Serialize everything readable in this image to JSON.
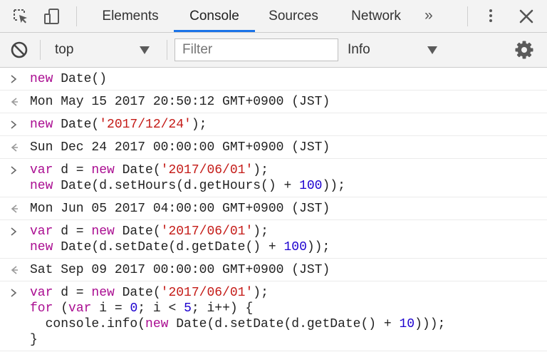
{
  "tabs": {
    "items": [
      "Elements",
      "Console",
      "Sources",
      "Network"
    ],
    "active": "Console",
    "more_label": "»"
  },
  "toolbar": {
    "context_value": "top",
    "filter_placeholder": "Filter",
    "level_value": "Info"
  },
  "icons": {
    "inspect": "inspect-element-icon",
    "device": "device-toolbar-icon",
    "more_tabs": "chevron-double-right-icon",
    "menu": "kebab-menu-icon",
    "close": "close-icon",
    "clear": "clear-console-icon",
    "dropdown": "chevron-down-icon",
    "settings": "gear-icon",
    "input_prompt": "input-prompt-icon",
    "result_prompt": "result-prompt-icon"
  },
  "colors": {
    "accent": "#1a73e8",
    "keyword": "#aa0d91",
    "string": "#c41a16",
    "number": "#1c00cf",
    "text": "#222222"
  },
  "console": {
    "entries": [
      {
        "kind": "input",
        "lines": [
          [
            [
              "kw",
              "new"
            ],
            [
              "plain",
              " Date()"
            ]
          ]
        ]
      },
      {
        "kind": "result",
        "lines": [
          [
            [
              "plain",
              "Mon May 15 2017 20:50:12 GMT+0900 (JST)"
            ]
          ]
        ]
      },
      {
        "kind": "input",
        "lines": [
          [
            [
              "kw",
              "new"
            ],
            [
              "plain",
              " Date("
            ],
            [
              "str",
              "'2017/12/24'"
            ],
            [
              "plain",
              ");"
            ]
          ]
        ]
      },
      {
        "kind": "result",
        "lines": [
          [
            [
              "plain",
              "Sun Dec 24 2017 00:00:00 GMT+0900 (JST)"
            ]
          ]
        ]
      },
      {
        "kind": "input",
        "lines": [
          [
            [
              "kw",
              "var"
            ],
            [
              "plain",
              " d = "
            ],
            [
              "kw",
              "new"
            ],
            [
              "plain",
              " Date("
            ],
            [
              "str",
              "'2017/06/01'"
            ],
            [
              "plain",
              ");"
            ]
          ],
          [
            [
              "kw",
              "new"
            ],
            [
              "plain",
              " Date(d.setHours(d.getHours() + "
            ],
            [
              "num",
              "100"
            ],
            [
              "plain",
              "));"
            ]
          ]
        ]
      },
      {
        "kind": "result",
        "lines": [
          [
            [
              "plain",
              "Mon Jun 05 2017 04:00:00 GMT+0900 (JST)"
            ]
          ]
        ]
      },
      {
        "kind": "input",
        "lines": [
          [
            [
              "kw",
              "var"
            ],
            [
              "plain",
              " d = "
            ],
            [
              "kw",
              "new"
            ],
            [
              "plain",
              " Date("
            ],
            [
              "str",
              "'2017/06/01'"
            ],
            [
              "plain",
              ");"
            ]
          ],
          [
            [
              "kw",
              "new"
            ],
            [
              "plain",
              " Date(d.setDate(d.getDate() + "
            ],
            [
              "num",
              "100"
            ],
            [
              "plain",
              "));"
            ]
          ]
        ]
      },
      {
        "kind": "result",
        "lines": [
          [
            [
              "plain",
              "Sat Sep 09 2017 00:00:00 GMT+0900 (JST)"
            ]
          ]
        ]
      },
      {
        "kind": "input",
        "lines": [
          [
            [
              "kw",
              "var"
            ],
            [
              "plain",
              " d = "
            ],
            [
              "kw",
              "new"
            ],
            [
              "plain",
              " Date("
            ],
            [
              "str",
              "'2017/06/01'"
            ],
            [
              "plain",
              ");"
            ]
          ],
          [
            [
              "kw",
              "for"
            ],
            [
              "plain",
              " ("
            ],
            [
              "kw",
              "var"
            ],
            [
              "plain",
              " i = "
            ],
            [
              "num",
              "0"
            ],
            [
              "plain",
              "; i < "
            ],
            [
              "num",
              "5"
            ],
            [
              "plain",
              "; i++) {"
            ]
          ],
          [
            [
              "plain",
              "  console.info("
            ],
            [
              "kw",
              "new"
            ],
            [
              "plain",
              " Date(d.setDate(d.getDate() + "
            ],
            [
              "num",
              "10"
            ],
            [
              "plain",
              ")));"
            ]
          ],
          [
            [
              "plain",
              "}"
            ]
          ]
        ]
      }
    ]
  }
}
